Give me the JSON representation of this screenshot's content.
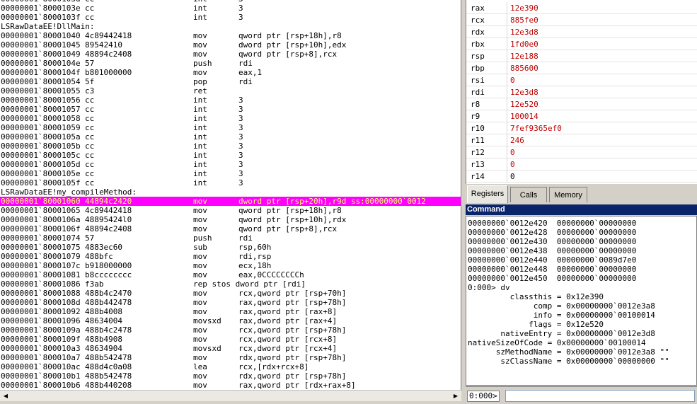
{
  "disassembly": {
    "lines": [
      {
        "kind": "code",
        "addr": "00000001`8000103d",
        "bytes": "cc",
        "mnemonic": "int",
        "operands": "3"
      },
      {
        "kind": "code",
        "addr": "00000001`8000103e",
        "bytes": "cc",
        "mnemonic": "int",
        "operands": "3"
      },
      {
        "kind": "code",
        "addr": "00000001`8000103f",
        "bytes": "cc",
        "mnemonic": "int",
        "operands": "3"
      },
      {
        "kind": "label",
        "text": "LSRawDataEE!DllMain:"
      },
      {
        "kind": "code",
        "addr": "00000001`80001040",
        "bytes": "4c89442418",
        "mnemonic": "mov",
        "operands": "qword ptr [rsp+18h],r8"
      },
      {
        "kind": "code",
        "addr": "00000001`80001045",
        "bytes": "89542410",
        "mnemonic": "mov",
        "operands": "dword ptr [rsp+10h],edx"
      },
      {
        "kind": "code",
        "addr": "00000001`80001049",
        "bytes": "48894c2408",
        "mnemonic": "mov",
        "operands": "qword ptr [rsp+8],rcx"
      },
      {
        "kind": "code",
        "addr": "00000001`8000104e",
        "bytes": "57",
        "mnemonic": "push",
        "operands": "rdi"
      },
      {
        "kind": "code",
        "addr": "00000001`8000104f",
        "bytes": "b801000000",
        "mnemonic": "mov",
        "operands": "eax,1"
      },
      {
        "kind": "code",
        "addr": "00000001`80001054",
        "bytes": "5f",
        "mnemonic": "pop",
        "operands": "rdi"
      },
      {
        "kind": "code",
        "addr": "00000001`80001055",
        "bytes": "c3",
        "mnemonic": "ret",
        "operands": ""
      },
      {
        "kind": "code",
        "addr": "00000001`80001056",
        "bytes": "cc",
        "mnemonic": "int",
        "operands": "3"
      },
      {
        "kind": "code",
        "addr": "00000001`80001057",
        "bytes": "cc",
        "mnemonic": "int",
        "operands": "3"
      },
      {
        "kind": "code",
        "addr": "00000001`80001058",
        "bytes": "cc",
        "mnemonic": "int",
        "operands": "3"
      },
      {
        "kind": "code",
        "addr": "00000001`80001059",
        "bytes": "cc",
        "mnemonic": "int",
        "operands": "3"
      },
      {
        "kind": "code",
        "addr": "00000001`8000105a",
        "bytes": "cc",
        "mnemonic": "int",
        "operands": "3"
      },
      {
        "kind": "code",
        "addr": "00000001`8000105b",
        "bytes": "cc",
        "mnemonic": "int",
        "operands": "3"
      },
      {
        "kind": "code",
        "addr": "00000001`8000105c",
        "bytes": "cc",
        "mnemonic": "int",
        "operands": "3"
      },
      {
        "kind": "code",
        "addr": "00000001`8000105d",
        "bytes": "cc",
        "mnemonic": "int",
        "operands": "3"
      },
      {
        "kind": "code",
        "addr": "00000001`8000105e",
        "bytes": "cc",
        "mnemonic": "int",
        "operands": "3"
      },
      {
        "kind": "code",
        "addr": "00000001`8000105f",
        "bytes": "cc",
        "mnemonic": "int",
        "operands": "3"
      },
      {
        "kind": "label",
        "text": "LSRawDataEE!my_compileMethod:"
      },
      {
        "kind": "code",
        "current": true,
        "addr": "00000001`80001060",
        "bytes": "44894c2420",
        "mnemonic": "mov",
        "operands": "dword ptr [rsp+20h],r9d ss:00000000`0012"
      },
      {
        "kind": "code",
        "addr": "00000001`80001065",
        "bytes": "4c89442418",
        "mnemonic": "mov",
        "operands": "qword ptr [rsp+18h],r8"
      },
      {
        "kind": "code",
        "addr": "00000001`8000106a",
        "bytes": "48895424l0",
        "mnemonic": "mov",
        "operands": "qword ptr [rsp+10h],rdx"
      },
      {
        "kind": "code",
        "addr": "00000001`8000106f",
        "bytes": "48894c2408",
        "mnemonic": "mov",
        "operands": "qword ptr [rsp+8],rcx"
      },
      {
        "kind": "code",
        "addr": "00000001`80001074",
        "bytes": "57",
        "mnemonic": "push",
        "operands": "rdi"
      },
      {
        "kind": "code",
        "addr": "00000001`80001075",
        "bytes": "4883ec60",
        "mnemonic": "sub",
        "operands": "rsp,60h"
      },
      {
        "kind": "code",
        "addr": "00000001`80001079",
        "bytes": "488bfc",
        "mnemonic": "mov",
        "operands": "rdi,rsp"
      },
      {
        "kind": "code",
        "addr": "00000001`8000107c",
        "bytes": "b918000000",
        "mnemonic": "mov",
        "operands": "ecx,18h"
      },
      {
        "kind": "code",
        "addr": "00000001`80001081",
        "bytes": "b8cccccccc",
        "mnemonic": "mov",
        "operands": "eax,0CCCCCCCCh"
      },
      {
        "kind": "code",
        "addr": "00000001`80001086",
        "bytes": "f3ab",
        "mnemonic": "rep stos dword ptr [rdi]",
        "operands": ""
      },
      {
        "kind": "code",
        "addr": "00000001`80001088",
        "bytes": "488b4c2470",
        "mnemonic": "mov",
        "operands": "rcx,qword ptr [rsp+70h]"
      },
      {
        "kind": "code",
        "addr": "00000001`8000108d",
        "bytes": "488b442478",
        "mnemonic": "mov",
        "operands": "rax,qword ptr [rsp+78h]"
      },
      {
        "kind": "code",
        "addr": "00000001`80001092",
        "bytes": "488b4008",
        "mnemonic": "mov",
        "operands": "rax,qword ptr [rax+8]"
      },
      {
        "kind": "code",
        "addr": "00000001`80001096",
        "bytes": "48634004",
        "mnemonic": "movsxd",
        "operands": "rax,dword ptr [rax+4]"
      },
      {
        "kind": "code",
        "addr": "00000001`8000109a",
        "bytes": "488b4c2478",
        "mnemonic": "mov",
        "operands": "rcx,qword ptr [rsp+78h]"
      },
      {
        "kind": "code",
        "addr": "00000001`8000109f",
        "bytes": "488b4908",
        "mnemonic": "mov",
        "operands": "rcx,qword ptr [rcx+8]"
      },
      {
        "kind": "code",
        "addr": "00000001`800010a3",
        "bytes": "48634904",
        "mnemonic": "movsxd",
        "operands": "rcx,dword ptr [rcx+4]"
      },
      {
        "kind": "code",
        "addr": "00000001`800010a7",
        "bytes": "488b542478",
        "mnemonic": "mov",
        "operands": "rdx,qword ptr [rsp+78h]"
      },
      {
        "kind": "code",
        "addr": "00000001`800010ac",
        "bytes": "488d4c0a08",
        "mnemonic": "lea",
        "operands": "rcx,[rdx+rcx+8]"
      },
      {
        "kind": "code",
        "addr": "00000001`800010b1",
        "bytes": "488b542478",
        "mnemonic": "mov",
        "operands": "rdx,qword ptr [rsp+78h]"
      },
      {
        "kind": "code",
        "addr": "00000001`800010b6",
        "bytes": "488b440208",
        "mnemonic": "mov",
        "operands": "rax,qword ptr [rdx+rax+8]"
      }
    ]
  },
  "registers": {
    "rows": [
      {
        "name": "rax",
        "value": "12e390",
        "changed": true
      },
      {
        "name": "rcx",
        "value": "885fe0",
        "changed": true
      },
      {
        "name": "rdx",
        "value": "12e3d8",
        "changed": true
      },
      {
        "name": "rbx",
        "value": "1fd0e0",
        "changed": true
      },
      {
        "name": "rsp",
        "value": "12e188",
        "changed": true
      },
      {
        "name": "rbp",
        "value": "885600",
        "changed": true
      },
      {
        "name": "rsi",
        "value": "0",
        "changed": true
      },
      {
        "name": "rdi",
        "value": "12e3d8",
        "changed": true
      },
      {
        "name": "r8",
        "value": "12e520",
        "changed": true
      },
      {
        "name": "r9",
        "value": "100014",
        "changed": true
      },
      {
        "name": "r10",
        "value": "7fef9365ef0",
        "changed": true
      },
      {
        "name": "r11",
        "value": "246",
        "changed": true
      },
      {
        "name": "r12",
        "value": "0",
        "changed": true
      },
      {
        "name": "r13",
        "value": "0",
        "changed": true
      },
      {
        "name": "r14",
        "value": "0",
        "changed": false
      }
    ]
  },
  "tabs": [
    {
      "label": "Registers",
      "active": true
    },
    {
      "label": "Calls",
      "active": false
    },
    {
      "label": "Memory",
      "active": false
    }
  ],
  "command": {
    "title": "Command",
    "lines": [
      "00000000`0012e420  00000000`00000000",
      "00000000`0012e428  00000000`00000000",
      "00000000`0012e430  00000000`00000000",
      "00000000`0012e438  00000000`00000000",
      "00000000`0012e440  00000000`0089d7e0",
      "00000000`0012e448  00000000`00000000",
      "00000000`0012e450  00000000`00000000",
      "0:000> dv",
      "         classthis = 0x12e390",
      "              comp = 0x00000000`0012e3a8",
      "              info = 0x00000000`00100014",
      "             flags = 0x12e520",
      "       nativeEntry = 0x00000000`0012e3d8",
      "nativeSizeOfCode = 0x00000000`00100014",
      "      szMethodName = 0x00000000`0012e3a8 \"\"",
      "       szClassName = 0x00000000`00000000 \"\""
    ],
    "prompt": "0:000>",
    "input_value": ""
  },
  "colors": {
    "current_line_bg": "#ff00ff",
    "current_line_fg": "#ffff66",
    "changed_register": "#c00000",
    "title_bar": "#0a246a"
  }
}
